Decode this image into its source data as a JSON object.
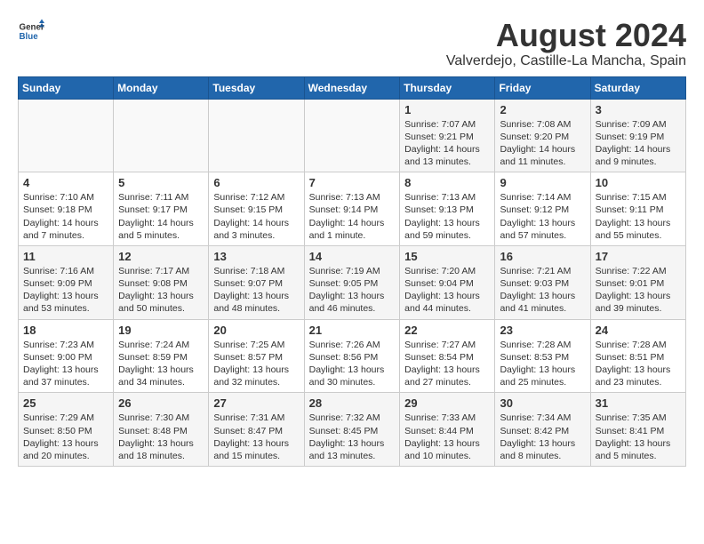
{
  "header": {
    "logo": {
      "general": "General",
      "blue": "Blue"
    },
    "title": "August 2024",
    "location": "Valverdejo, Castille-La Mancha, Spain"
  },
  "weekdays": [
    "Sunday",
    "Monday",
    "Tuesday",
    "Wednesday",
    "Thursday",
    "Friday",
    "Saturday"
  ],
  "weeks": [
    [
      {
        "day": "",
        "info": ""
      },
      {
        "day": "",
        "info": ""
      },
      {
        "day": "",
        "info": ""
      },
      {
        "day": "",
        "info": ""
      },
      {
        "day": "1",
        "info": "Sunrise: 7:07 AM\nSunset: 9:21 PM\nDaylight: 14 hours\nand 13 minutes."
      },
      {
        "day": "2",
        "info": "Sunrise: 7:08 AM\nSunset: 9:20 PM\nDaylight: 14 hours\nand 11 minutes."
      },
      {
        "day": "3",
        "info": "Sunrise: 7:09 AM\nSunset: 9:19 PM\nDaylight: 14 hours\nand 9 minutes."
      }
    ],
    [
      {
        "day": "4",
        "info": "Sunrise: 7:10 AM\nSunset: 9:18 PM\nDaylight: 14 hours\nand 7 minutes."
      },
      {
        "day": "5",
        "info": "Sunrise: 7:11 AM\nSunset: 9:17 PM\nDaylight: 14 hours\nand 5 minutes."
      },
      {
        "day": "6",
        "info": "Sunrise: 7:12 AM\nSunset: 9:15 PM\nDaylight: 14 hours\nand 3 minutes."
      },
      {
        "day": "7",
        "info": "Sunrise: 7:13 AM\nSunset: 9:14 PM\nDaylight: 14 hours\nand 1 minute."
      },
      {
        "day": "8",
        "info": "Sunrise: 7:13 AM\nSunset: 9:13 PM\nDaylight: 13 hours\nand 59 minutes."
      },
      {
        "day": "9",
        "info": "Sunrise: 7:14 AM\nSunset: 9:12 PM\nDaylight: 13 hours\nand 57 minutes."
      },
      {
        "day": "10",
        "info": "Sunrise: 7:15 AM\nSunset: 9:11 PM\nDaylight: 13 hours\nand 55 minutes."
      }
    ],
    [
      {
        "day": "11",
        "info": "Sunrise: 7:16 AM\nSunset: 9:09 PM\nDaylight: 13 hours\nand 53 minutes."
      },
      {
        "day": "12",
        "info": "Sunrise: 7:17 AM\nSunset: 9:08 PM\nDaylight: 13 hours\nand 50 minutes."
      },
      {
        "day": "13",
        "info": "Sunrise: 7:18 AM\nSunset: 9:07 PM\nDaylight: 13 hours\nand 48 minutes."
      },
      {
        "day": "14",
        "info": "Sunrise: 7:19 AM\nSunset: 9:05 PM\nDaylight: 13 hours\nand 46 minutes."
      },
      {
        "day": "15",
        "info": "Sunrise: 7:20 AM\nSunset: 9:04 PM\nDaylight: 13 hours\nand 44 minutes."
      },
      {
        "day": "16",
        "info": "Sunrise: 7:21 AM\nSunset: 9:03 PM\nDaylight: 13 hours\nand 41 minutes."
      },
      {
        "day": "17",
        "info": "Sunrise: 7:22 AM\nSunset: 9:01 PM\nDaylight: 13 hours\nand 39 minutes."
      }
    ],
    [
      {
        "day": "18",
        "info": "Sunrise: 7:23 AM\nSunset: 9:00 PM\nDaylight: 13 hours\nand 37 minutes."
      },
      {
        "day": "19",
        "info": "Sunrise: 7:24 AM\nSunset: 8:59 PM\nDaylight: 13 hours\nand 34 minutes."
      },
      {
        "day": "20",
        "info": "Sunrise: 7:25 AM\nSunset: 8:57 PM\nDaylight: 13 hours\nand 32 minutes."
      },
      {
        "day": "21",
        "info": "Sunrise: 7:26 AM\nSunset: 8:56 PM\nDaylight: 13 hours\nand 30 minutes."
      },
      {
        "day": "22",
        "info": "Sunrise: 7:27 AM\nSunset: 8:54 PM\nDaylight: 13 hours\nand 27 minutes."
      },
      {
        "day": "23",
        "info": "Sunrise: 7:28 AM\nSunset: 8:53 PM\nDaylight: 13 hours\nand 25 minutes."
      },
      {
        "day": "24",
        "info": "Sunrise: 7:28 AM\nSunset: 8:51 PM\nDaylight: 13 hours\nand 23 minutes."
      }
    ],
    [
      {
        "day": "25",
        "info": "Sunrise: 7:29 AM\nSunset: 8:50 PM\nDaylight: 13 hours\nand 20 minutes."
      },
      {
        "day": "26",
        "info": "Sunrise: 7:30 AM\nSunset: 8:48 PM\nDaylight: 13 hours\nand 18 minutes."
      },
      {
        "day": "27",
        "info": "Sunrise: 7:31 AM\nSunset: 8:47 PM\nDaylight: 13 hours\nand 15 minutes."
      },
      {
        "day": "28",
        "info": "Sunrise: 7:32 AM\nSunset: 8:45 PM\nDaylight: 13 hours\nand 13 minutes."
      },
      {
        "day": "29",
        "info": "Sunrise: 7:33 AM\nSunset: 8:44 PM\nDaylight: 13 hours\nand 10 minutes."
      },
      {
        "day": "30",
        "info": "Sunrise: 7:34 AM\nSunset: 8:42 PM\nDaylight: 13 hours\nand 8 minutes."
      },
      {
        "day": "31",
        "info": "Sunrise: 7:35 AM\nSunset: 8:41 PM\nDaylight: 13 hours\nand 5 minutes."
      }
    ]
  ]
}
